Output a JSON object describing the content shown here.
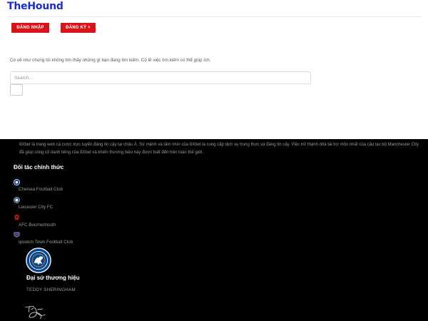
{
  "header": {
    "logo": "TheHound",
    "login_label": "ĐĂNG NHẬP",
    "register_label": "ĐĂNG KÝ +"
  },
  "content": {
    "not_found_text": "Có vẻ như chúng tôi không tìm thấy những gì bạn đang tìm kiếm. Có lẽ việc tìm kiếm có thể giúp ích.",
    "search_placeholder": "Search..."
  },
  "footer": {
    "about_text": "8Xbet là trang web cá cược trực tuyến đáng tin cậy tại châu Á. Sứ mệnh và tầm nhìn của 8Xbet là cung cấp dịch vụ trung thực và đáng tin cậy. Việc trở thành nhà tài trợ môn nhất của câu lạc bộ Manchester City đã giúp củng cố danh tiếng của 8Xbet và khiến thương hiệu này được biết đến trên toàn thế giới.",
    "partners_title": "Đối tác chính thức",
    "partners": [
      {
        "name": "Chelsea Football Club",
        "icon": "chelsea-icon"
      },
      {
        "name": "Leicester City FC",
        "icon": "leicester-icon"
      },
      {
        "name": "AFC Bournemouth",
        "icon": "bournemouth-icon"
      },
      {
        "name": "Ipswich Town Football Club",
        "icon": "ipswich-icon"
      }
    ],
    "ambassador_title": "Đại sứ thương hiệu",
    "ambassador_name": "TEDDY SHERINGHAM"
  },
  "colors": {
    "brand_blue": "#1a2bd8",
    "button_red": "#d7141a",
    "footer_bg": "#000000"
  }
}
